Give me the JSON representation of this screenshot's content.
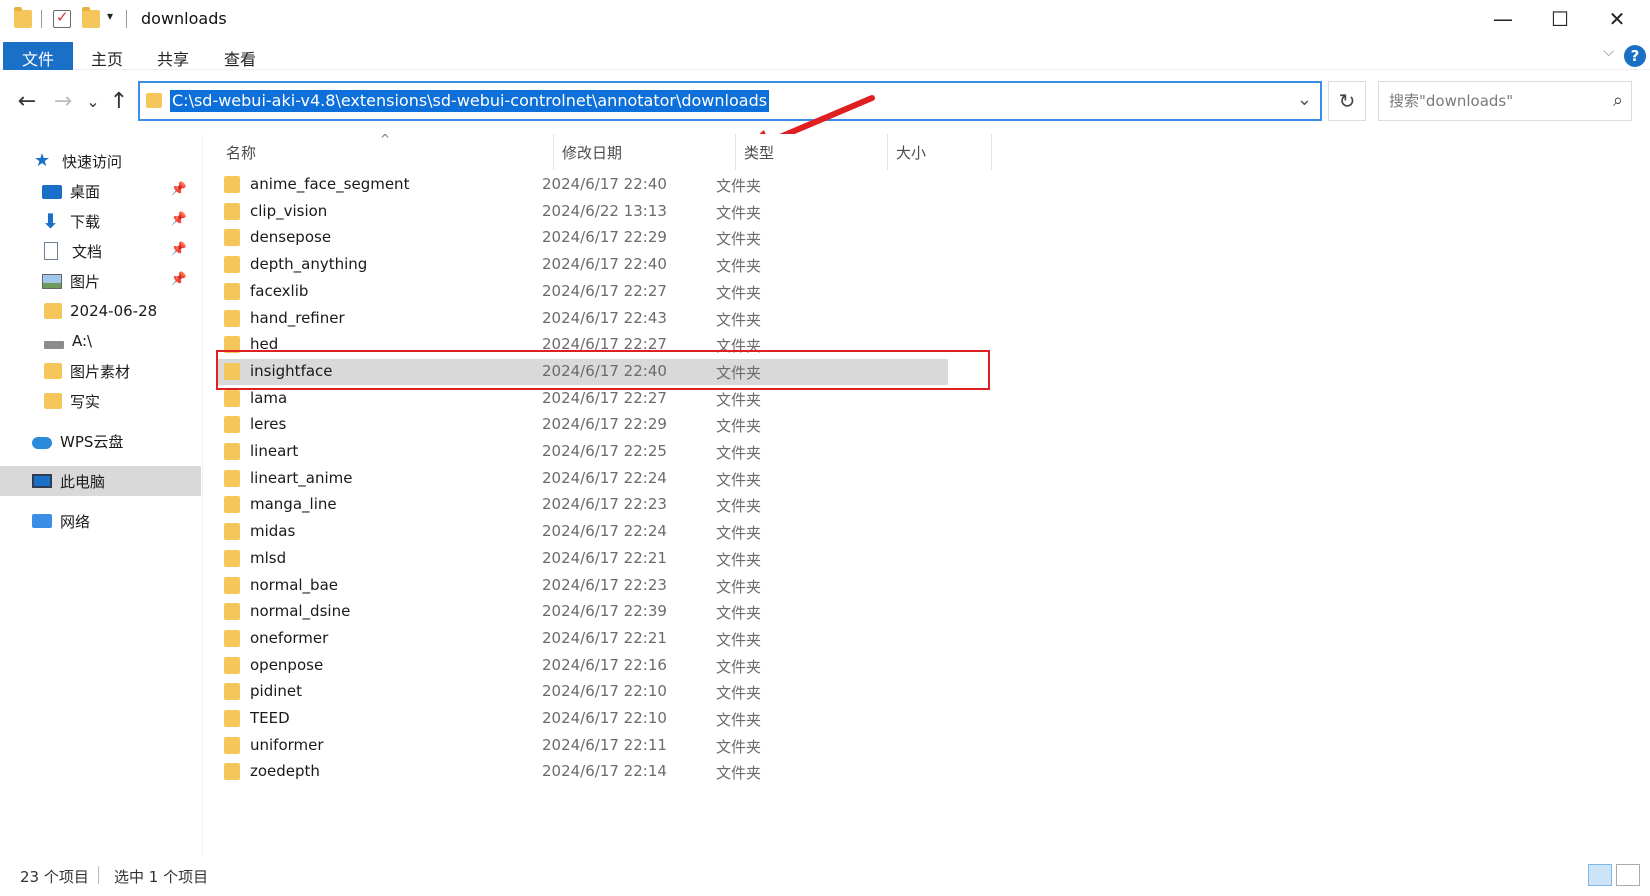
{
  "window": {
    "title": "downloads",
    "minimize_glyph": "—",
    "maximize_glyph": "☐",
    "close_glyph": "✕"
  },
  "ribbon": {
    "tabs": [
      "文件",
      "主页",
      "共享",
      "查看"
    ],
    "help_glyph": "?",
    "collapse_glyph": "⌵"
  },
  "nav": {
    "back_glyph": "←",
    "forward_glyph": "→",
    "recent_glyph": "⌄",
    "up_glyph": "↑",
    "address": "C:\\sd-webui-aki-v4.8\\extensions\\sd-webui-controlnet\\annotator\\downloads",
    "refresh_glyph": "↻",
    "search_placeholder": "搜索\"downloads\""
  },
  "sidebar": {
    "items": [
      {
        "label": "快速访问",
        "icon": "star-icon"
      },
      {
        "label": "桌面",
        "icon": "desktop-icon",
        "pinned": true
      },
      {
        "label": "下载",
        "icon": "download-icon",
        "pinned": true
      },
      {
        "label": "文档",
        "icon": "document-icon",
        "pinned": true
      },
      {
        "label": "图片",
        "icon": "pictures-icon",
        "pinned": true
      },
      {
        "label": "2024-06-28",
        "icon": "folder-icon"
      },
      {
        "label": "A:\\",
        "icon": "drive-icon"
      },
      {
        "label": "图片素材",
        "icon": "folder-icon"
      },
      {
        "label": "写实",
        "icon": "folder-icon"
      },
      {
        "label": "WPS云盘",
        "icon": "cloud-icon"
      },
      {
        "label": "此电脑",
        "icon": "computer-icon",
        "selected": true
      },
      {
        "label": "网络",
        "icon": "network-icon"
      }
    ]
  },
  "columns": {
    "name": "名称",
    "date": "修改日期",
    "type": "类型",
    "size": "大小"
  },
  "files": [
    {
      "name": "anime_face_segment",
      "date": "2024/6/17 22:40",
      "type": "文件夹"
    },
    {
      "name": "clip_vision",
      "date": "2024/6/22 13:13",
      "type": "文件夹"
    },
    {
      "name": "densepose",
      "date": "2024/6/17 22:29",
      "type": "文件夹"
    },
    {
      "name": "depth_anything",
      "date": "2024/6/17 22:40",
      "type": "文件夹"
    },
    {
      "name": "facexlib",
      "date": "2024/6/17 22:27",
      "type": "文件夹"
    },
    {
      "name": "hand_refiner",
      "date": "2024/6/17 22:43",
      "type": "文件夹"
    },
    {
      "name": "hed",
      "date": "2024/6/17 22:27",
      "type": "文件夹"
    },
    {
      "name": "insightface",
      "date": "2024/6/17 22:40",
      "type": "文件夹",
      "selected": true
    },
    {
      "name": "lama",
      "date": "2024/6/17 22:27",
      "type": "文件夹"
    },
    {
      "name": "leres",
      "date": "2024/6/17 22:29",
      "type": "文件夹"
    },
    {
      "name": "lineart",
      "date": "2024/6/17 22:25",
      "type": "文件夹"
    },
    {
      "name": "lineart_anime",
      "date": "2024/6/17 22:24",
      "type": "文件夹"
    },
    {
      "name": "manga_line",
      "date": "2024/6/17 22:23",
      "type": "文件夹"
    },
    {
      "name": "midas",
      "date": "2024/6/17 22:24",
      "type": "文件夹"
    },
    {
      "name": "mlsd",
      "date": "2024/6/17 22:21",
      "type": "文件夹"
    },
    {
      "name": "normal_bae",
      "date": "2024/6/17 22:23",
      "type": "文件夹"
    },
    {
      "name": "normal_dsine",
      "date": "2024/6/17 22:39",
      "type": "文件夹"
    },
    {
      "name": "oneformer",
      "date": "2024/6/17 22:21",
      "type": "文件夹"
    },
    {
      "name": "openpose",
      "date": "2024/6/17 22:16",
      "type": "文件夹"
    },
    {
      "name": "pidinet",
      "date": "2024/6/17 22:10",
      "type": "文件夹"
    },
    {
      "name": "TEED",
      "date": "2024/6/17 22:10",
      "type": "文件夹"
    },
    {
      "name": "uniformer",
      "date": "2024/6/17 22:11",
      "type": "文件夹"
    },
    {
      "name": "zoedepth",
      "date": "2024/6/17 22:14",
      "type": "文件夹"
    }
  ],
  "status": {
    "count": "23 个项目",
    "selection": "选中 1 个项目"
  },
  "colors": {
    "accent": "#1a6fc6",
    "selection": "#d9d9d9",
    "annotation": "#e02020",
    "folder": "#f5c75a"
  }
}
